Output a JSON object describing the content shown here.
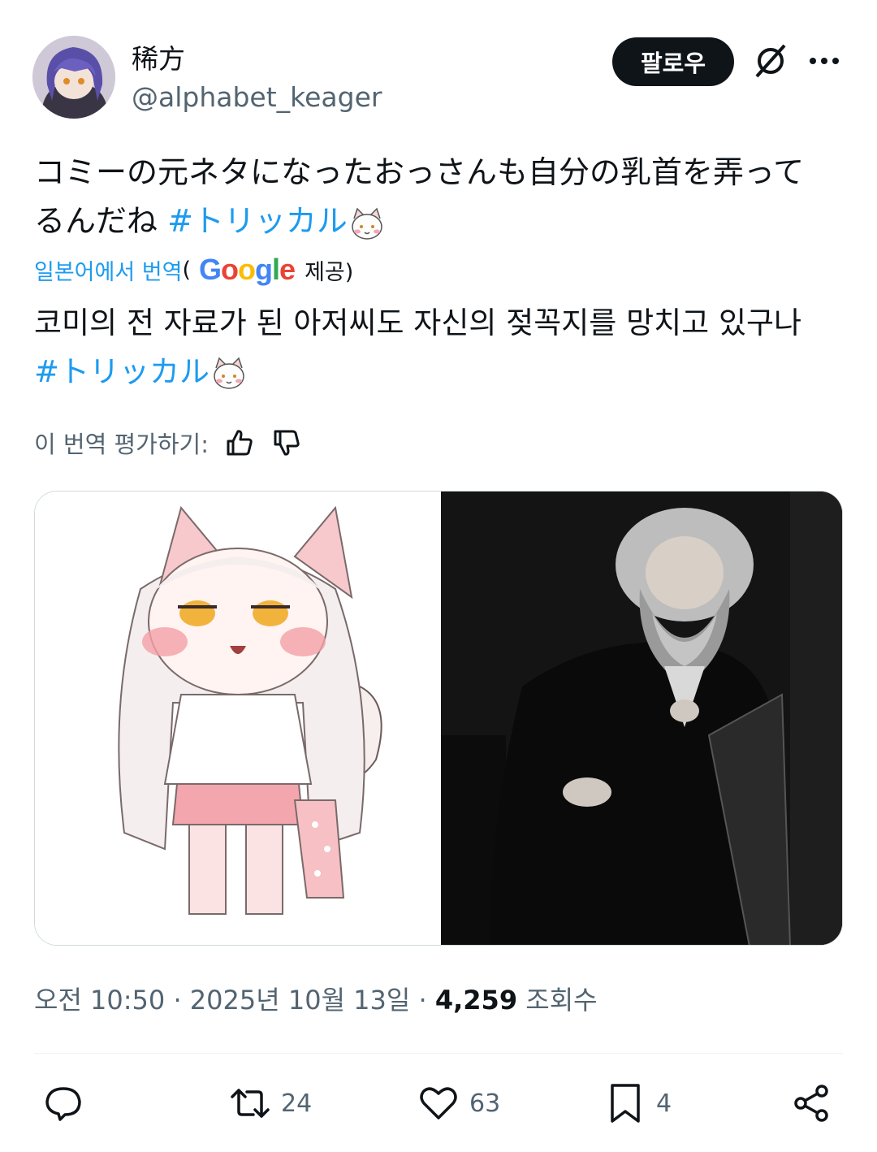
{
  "author": {
    "display_name": "稀方",
    "handle": "@alphabet_keager"
  },
  "follow_button": "팔로우",
  "tweet": {
    "line1": "コミーの元ネタになったおっさんも自分の乳首を弄って",
    "line2_prefix": "るんだね ",
    "hashtag": "#トリッカル"
  },
  "translation": {
    "link": "일본어에서 번역",
    "open_paren": "(",
    "google": [
      "G",
      "o",
      "o",
      "g",
      "l",
      "e"
    ],
    "provided": "제공)",
    "line1": "코미의 전 자료가 된 아저씨도 자신의 젖꼭지를 망치고 있구나",
    "hashtag": "#トリッカル"
  },
  "rate": {
    "label": "이 번역 평가하기:"
  },
  "meta": {
    "time": "오전 10:50",
    "sep1": " · ",
    "date": "2025년 10월 13일",
    "sep2": " · ",
    "views": "4,259",
    "views_label": " 조회수"
  },
  "actions": {
    "reply_count": "",
    "retweet_count": "24",
    "like_count": "63",
    "bookmark_count": "4"
  },
  "colors": {
    "accent": "#1d9bf0",
    "text": "#0f1419",
    "muted": "#536471",
    "google_blue": "#4285F4",
    "google_red": "#EA4335",
    "google_yellow": "#FBBC05",
    "google_green": "#34A853"
  },
  "icons": [
    "grok-icon",
    "more-icon",
    "thumbs-up-icon",
    "thumbs-down-icon",
    "reply-icon",
    "retweet-icon",
    "heart-icon",
    "bookmark-icon",
    "share-icon"
  ]
}
